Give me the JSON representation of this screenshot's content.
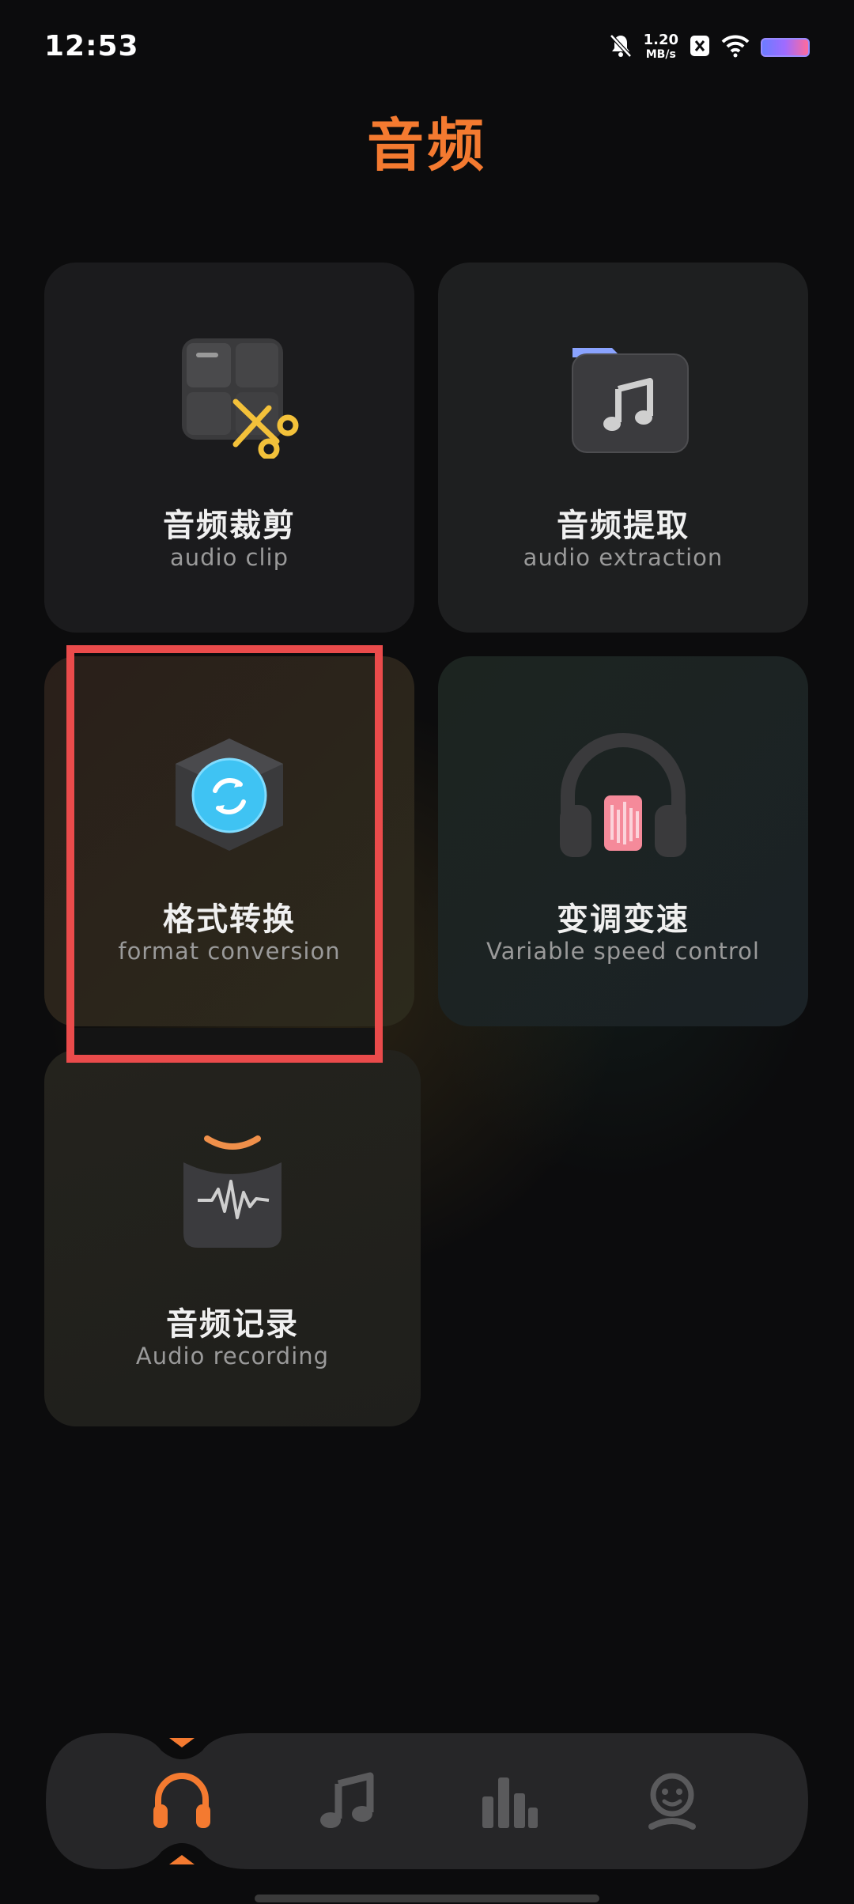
{
  "status_bar": {
    "time": "12:53",
    "net_speed_value": "1.20",
    "net_speed_unit": "MB/s",
    "icons": [
      "bell-off-icon",
      "close-box-icon",
      "wifi-icon",
      "battery-icon"
    ]
  },
  "page": {
    "title": "音频"
  },
  "tools": [
    {
      "label_cn": "音频裁剪",
      "label_en": "audio clip",
      "icon": "scissors-grid-icon"
    },
    {
      "label_cn": "音频提取",
      "label_en": "audio extraction",
      "icon": "music-folder-icon"
    },
    {
      "label_cn": "格式转换",
      "label_en": "format conversion",
      "icon": "convert-cube-icon",
      "highlighted": true
    },
    {
      "label_cn": "变调变速",
      "label_en": "Variable speed control",
      "icon": "headphones-icon"
    },
    {
      "label_cn": "音频记录",
      "label_en": "Audio recording",
      "icon": "waveform-recorder-icon"
    }
  ],
  "tab_bar": {
    "tabs": [
      {
        "name": "headphones-tab",
        "icon": "headphones-icon",
        "active": true
      },
      {
        "name": "music-tab",
        "icon": "music-note-icon",
        "active": false
      },
      {
        "name": "equalizer-tab",
        "icon": "bar-chart-icon",
        "active": false
      },
      {
        "name": "profile-tab",
        "icon": "profile-face-icon",
        "active": false
      }
    ]
  },
  "colors": {
    "accent": "#f47a30",
    "highlight_box": "#ea4b4b",
    "card_bg": "#1b1b1d",
    "page_bg": "#0c0c0d"
  }
}
